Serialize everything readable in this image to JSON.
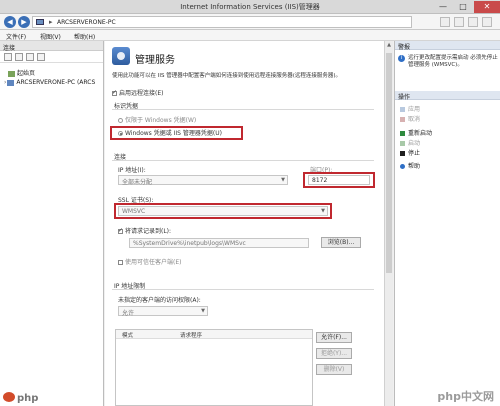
{
  "window": {
    "title": "Internet Information Services (IIS)管理器",
    "minimize": "—",
    "maximize": "□",
    "close": "✕"
  },
  "address": {
    "separator": "▸",
    "server": "ARCSERVERONE-PC",
    "back": "◀",
    "forward": "▶"
  },
  "menu": {
    "file": "文件(F)",
    "view": "视图(V)",
    "help": "帮助(H)"
  },
  "connections": {
    "header": "连接",
    "tree": [
      {
        "label": "起始页"
      },
      {
        "label": "ARCSERVERONE-PC (ARCS"
      }
    ]
  },
  "main": {
    "title": "管理服务",
    "description": "使用此功能可以在 IIS 管理器中配置客户端如何连接到使用远程连接服务器(远程连接服务器)。",
    "enable_remote": "启用远程连接(E)",
    "identity_header": "标识凭据",
    "windows_only": "仅限于 Windows 凭据(W)",
    "windows_or_iis": "Windows 凭据或 IIS 管理器凭据(U)",
    "connection_header": "连接",
    "ip_label": "IP 地址(I):",
    "ip_value": "全部未分配",
    "port_label": "端口(P):",
    "port_value": "8172",
    "ssl_label": "SSL 证书(S):",
    "ssl_value": "WMSVC",
    "log_requests": "将请求记录到(L):",
    "log_path": "%SystemDrive%\\inetpub\\logs\\WMSvc",
    "browse_btn": "浏览(B)...",
    "ipv6_fallback": "使用可信任客户端(E)",
    "ip_restrict_header": "IP 地址限制",
    "unspecified_label": "未指定的客户端的访问权限(A):",
    "unspecified_value": "允许",
    "col_mode": "模式",
    "col_requester": "请求程序",
    "allow_btn": "允许(F)...",
    "deny_btn": "拒绝(Y)...",
    "remove_btn": "删除(V)"
  },
  "actions": {
    "alerts_header": "警报",
    "alert_text": "远行更改配置提示需启动 必须先停止管理服务 (WMSVC)。",
    "actions_header": "操作",
    "items": [
      {
        "label": "应用",
        "enabled": false
      },
      {
        "label": "取消",
        "enabled": false
      },
      {
        "label": "重新启动",
        "enabled": true
      },
      {
        "label": "启动",
        "enabled": false
      },
      {
        "label": "停止",
        "enabled": true
      },
      {
        "label": "帮助",
        "enabled": true
      }
    ]
  },
  "watermark": "php中文网",
  "colors": {
    "highlight_box": "#c0282f",
    "nav_blue": "#3b6fb6",
    "actions_header_bg": "#dfe6f0"
  }
}
